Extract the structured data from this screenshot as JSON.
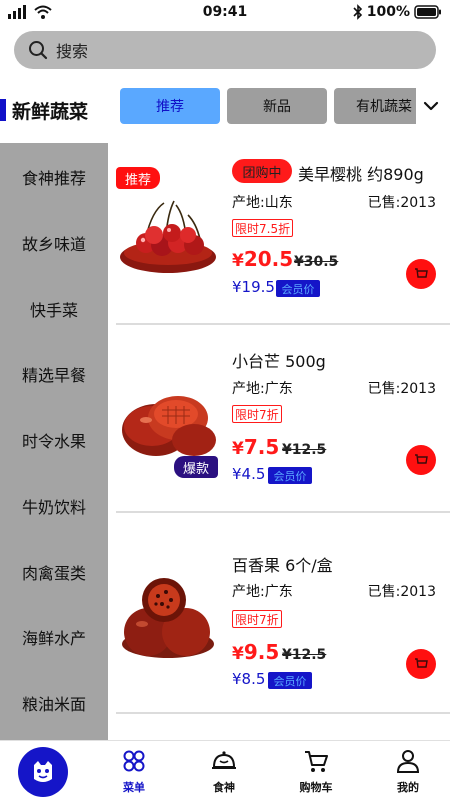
{
  "status_bar": {
    "time": "09:41",
    "battery": "100%"
  },
  "search": {
    "placeholder": "搜索"
  },
  "category": {
    "title": "新鲜蔬菜"
  },
  "tabs": [
    {
      "label": "推荐",
      "active": true
    },
    {
      "label": "新品",
      "active": false
    },
    {
      "label": "有机蔬菜",
      "active": false
    }
  ],
  "sidebar": {
    "items": [
      "食神推荐",
      "故乡味道",
      "快手菜",
      "精选早餐",
      "时令水果",
      "牛奶饮料",
      "肉禽蛋类",
      "海鲜水产",
      "粮油米面"
    ]
  },
  "products": [
    {
      "badge": "推荐",
      "group_tag": "团购中",
      "name": "美早樱桃 约890g",
      "origin": "产地:山东",
      "sold": "已售:2013",
      "discount": "限时7.5折",
      "price_symbol": "¥",
      "price": "20.5",
      "old_price": "¥30.5",
      "member_price": "¥19.5",
      "member_label": "会员价",
      "image_icon": "cherry-icon"
    },
    {
      "hot_badge": "爆款",
      "name": "小台芒 500g",
      "origin": "产地:广东",
      "sold": "已售:2013",
      "discount": "限时7折",
      "price_symbol": "¥",
      "price": "7.5",
      "old_price": "¥12.5",
      "member_price": "¥4.5",
      "member_label": "会员价",
      "image_icon": "mango-icon"
    },
    {
      "name": "百香果  6个/盒",
      "origin": "产地:广东",
      "sold": "已售:2013",
      "discount": "限时7折",
      "price_symbol": "¥",
      "price": "9.5",
      "old_price": "¥12.5",
      "member_price": "¥8.5",
      "member_label": "会员价",
      "image_icon": "passion-fruit-icon"
    }
  ],
  "bottom_nav": {
    "items": [
      {
        "label": "菜单",
        "icon": "menu-grid-icon",
        "active": true
      },
      {
        "label": "食神",
        "icon": "cloche-icon",
        "active": false
      },
      {
        "label": "购物车",
        "icon": "cart-icon",
        "active": false
      },
      {
        "label": "我的",
        "icon": "user-icon",
        "active": false
      }
    ]
  },
  "colors": {
    "accent": "#1515c8",
    "price_red": "#ff1a1a",
    "tab_active": "#5aa8ff",
    "sidebar_bg": "#a4a4a4"
  }
}
